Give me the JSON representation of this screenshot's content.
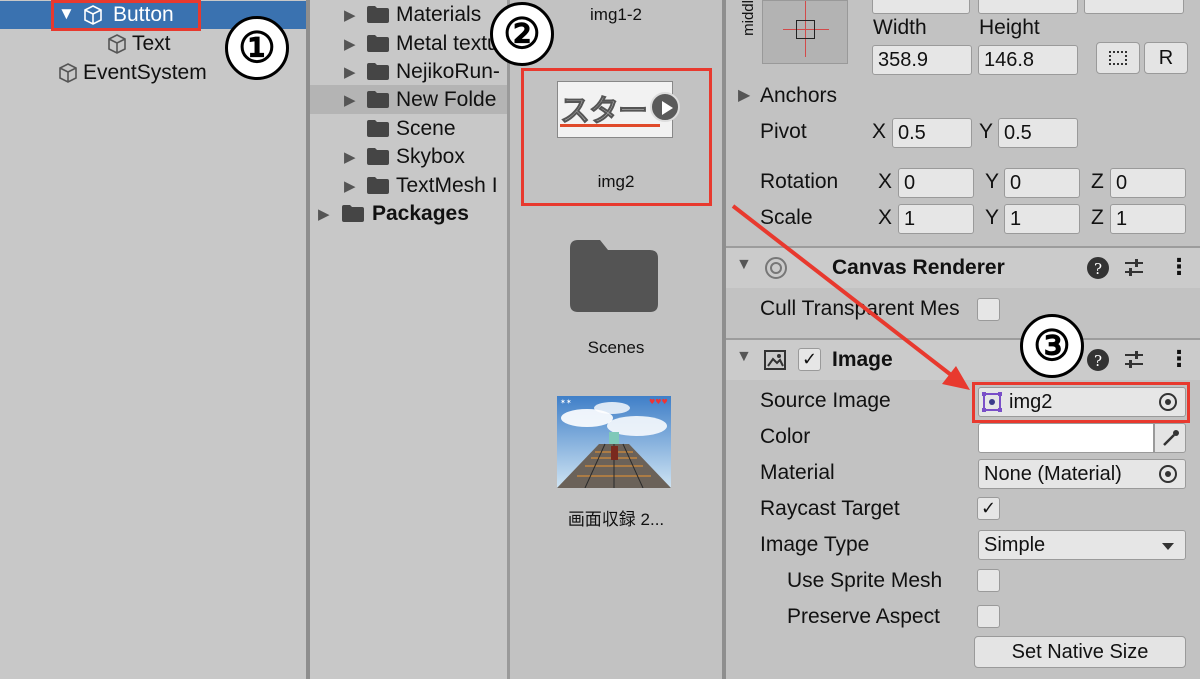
{
  "hierarchy": {
    "rows": [
      {
        "label": "Button",
        "selected": true
      },
      {
        "label": "Text"
      },
      {
        "label": "EventSystem"
      }
    ]
  },
  "project": {
    "tree": [
      {
        "label": "Materials"
      },
      {
        "label": "Metal textu"
      },
      {
        "label": "NejikoRun-"
      },
      {
        "label": "New Folde"
      },
      {
        "label": "Scene"
      },
      {
        "label": "Skybox"
      },
      {
        "label": "TextMesh I"
      },
      {
        "label": "Packages"
      }
    ],
    "assets": [
      {
        "label": "img1-2"
      },
      {
        "label": "img2",
        "thumb_text": "スター"
      },
      {
        "label": "Scenes"
      },
      {
        "label": "画面収録 2..."
      }
    ]
  },
  "inspector": {
    "rect": {
      "anchor_text": "middl",
      "width_label": "Width",
      "height_label": "Height",
      "width_value": "358.9",
      "height_value": "146.8",
      "r_button": "R"
    },
    "anchors_label": "Anchors",
    "pivot": {
      "label": "Pivot",
      "x_label": "X",
      "x": "0.5",
      "y_label": "Y",
      "y": "0.5"
    },
    "rotation": {
      "label": "Rotation",
      "x_label": "X",
      "x": "0",
      "y_label": "Y",
      "y": "0",
      "z_label": "Z",
      "z": "0"
    },
    "scale": {
      "label": "Scale",
      "x_label": "X",
      "x": "1",
      "y_label": "Y",
      "y": "1",
      "z_label": "Z",
      "z": "1"
    },
    "canvas_renderer": {
      "title": "Canvas Renderer",
      "cull_label": "Cull Transparent Mes"
    },
    "image": {
      "title": "Image",
      "source_image_label": "Source Image",
      "source_image_value": "img2",
      "color_label": "Color",
      "material_label": "Material",
      "material_value": "None (Material)",
      "raycast_label": "Raycast Target",
      "image_type_label": "Image Type",
      "image_type_value": "Simple",
      "use_sprite_mesh_label": "Use Sprite Mesh",
      "preserve_aspect_label": "Preserve Aspect",
      "set_native_size": "Set Native Size"
    },
    "header_glyphs": {
      "help": "?"
    }
  },
  "annotations": {
    "badge_1": "①",
    "badge_2": "②",
    "badge_3": "③"
  },
  "colors": {
    "selection": "#3a72b0",
    "highlight": "#e8392e"
  }
}
